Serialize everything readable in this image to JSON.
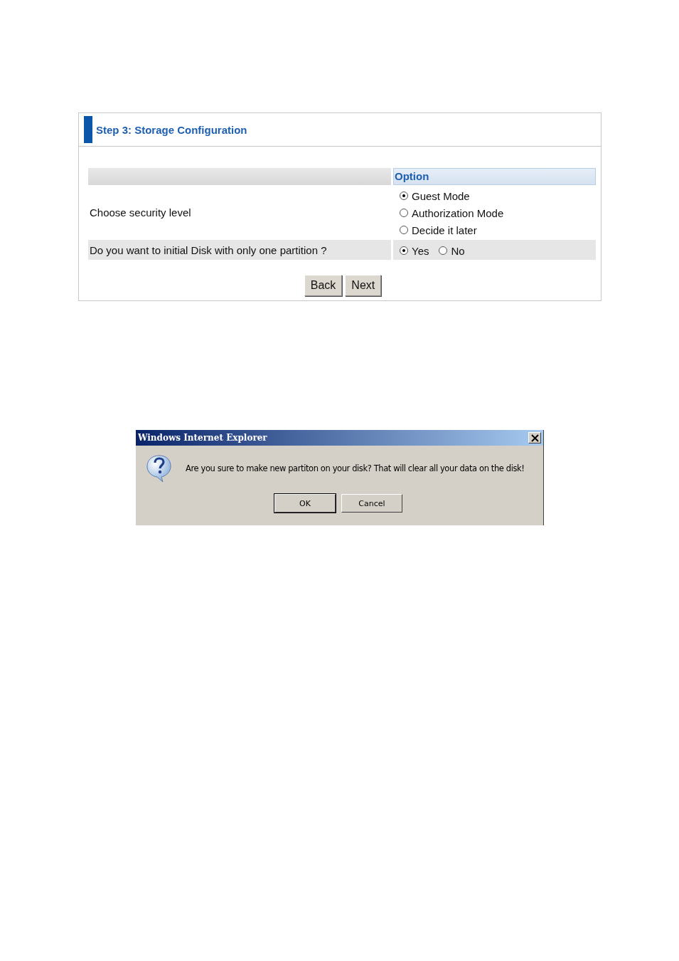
{
  "panel": {
    "title": "Step 3: Storage Configuration",
    "table": {
      "columns": [
        "",
        "Option"
      ],
      "rows": [
        {
          "label": "Choose security level",
          "shaded": false,
          "kind": "stacked",
          "options": [
            {
              "label": "Guest Mode",
              "selected": true
            },
            {
              "label": "Authorization Mode",
              "selected": false
            },
            {
              "label": "Decide it later",
              "selected": false
            }
          ]
        },
        {
          "label": "Do you want to initial Disk with only one partition ?",
          "shaded": true,
          "kind": "inline",
          "options": [
            {
              "label": "Yes",
              "selected": true
            },
            {
              "label": "No",
              "selected": false
            }
          ]
        }
      ]
    },
    "buttons": [
      "Back",
      "Next"
    ]
  },
  "dialog": {
    "title": "Windows Internet Explorer",
    "message": "Are you sure to make new partiton on your disk? That will clear all your data on the disk!",
    "buttons": [
      {
        "label": "OK",
        "default": true
      },
      {
        "label": "Cancel",
        "default": false
      }
    ]
  }
}
